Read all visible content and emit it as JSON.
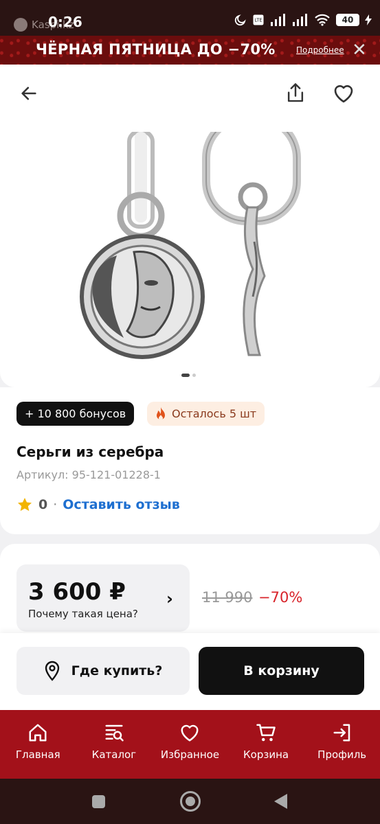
{
  "status_bar": {
    "time": "0:26",
    "app_label": "Kaspi.kz",
    "battery": "40"
  },
  "promo": {
    "text": "ЧЁРНАЯ ПЯТНИЦА  ДО −70%",
    "link": "Подробнее",
    "close": "✕"
  },
  "gallery": {
    "current_slide": 1,
    "total_slides": 2
  },
  "product": {
    "bonus_badge": "+ 10 800 бонусов",
    "stock_badge": "Осталось 5 шт",
    "title": "Серьги из серебра",
    "sku": "Артикул: 95-121-01228-1",
    "rating_count": "0",
    "rating_separator": "·",
    "review_link": "Оставить отзыв"
  },
  "price": {
    "current": "3 600 ₽",
    "question": "Почему такая цена?",
    "chevron": "›",
    "old": "11 990",
    "discount": "−70%"
  },
  "actions": {
    "where_buy": "Где купить?",
    "add_to_cart": "В корзину"
  },
  "bottom_nav": {
    "items": [
      {
        "label": "Главная",
        "icon": "home-icon"
      },
      {
        "label": "Каталог",
        "icon": "catalog-icon"
      },
      {
        "label": "Избранное",
        "icon": "heart-icon"
      },
      {
        "label": "Корзина",
        "icon": "cart-icon"
      },
      {
        "label": "Профиль",
        "icon": "login-icon"
      }
    ]
  },
  "colors": {
    "brand_red": "#a3111a",
    "link_blue": "#1e6fd0",
    "discount_red": "#d8232a",
    "star": "#f2b400"
  }
}
